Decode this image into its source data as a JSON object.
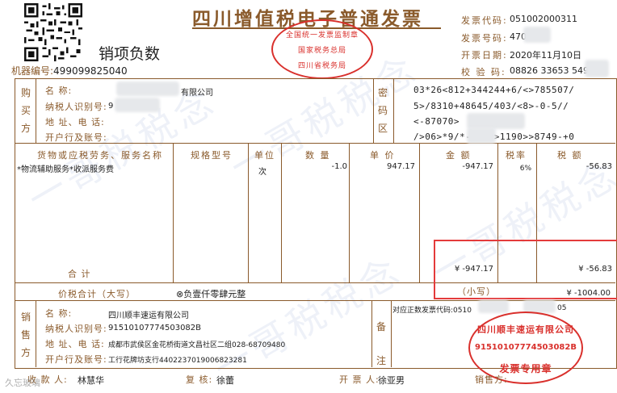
{
  "invoice": {
    "title": "四川增值税电子普通发票",
    "negative_mark": "销项负数",
    "machine_label": "机器编号:",
    "machine_no": "499099825040",
    "header": {
      "code_label": "发票代码:",
      "code": "051002000311",
      "no_label": "发票号码:",
      "no": "470",
      "date_label": "开票日期:",
      "date": "2020年11月10日",
      "check_label": "校 验 码:",
      "check": "08826 33653 549"
    }
  },
  "buyer": {
    "section": "购买方",
    "name_label": "名        称:",
    "name": "有限公司",
    "tax_label": "纳税人识别号:",
    "tax": "9",
    "addr_label": "地 址、电 话:",
    "bank_label": "开户行及账号:"
  },
  "cipher": {
    "section": "密码区",
    "lines": [
      "03*26<812+344244+6/<>785507/",
      "5>/8310+48645/403/<8>-0-5//",
      "<-87070>",
      "/>06>*9/*-11><>1190>>8749-+0"
    ]
  },
  "columns": {
    "name": "货物或应税劳务、服务名称",
    "spec": "规格型号",
    "unit": "单位",
    "qty": "数 量",
    "price": "单 价",
    "amount": "金 额",
    "rate": "税率",
    "tax": "税 额"
  },
  "items": [
    {
      "name": "*物流辅助服务*收派服务费",
      "unit": "次",
      "qty": "-1.0",
      "price": "947.17",
      "amount": "-947.17",
      "rate": "6%",
      "tax": "-56.83"
    }
  ],
  "totals": {
    "label": "合        计",
    "amount": "¥ -947.17",
    "tax": "¥ -56.83",
    "grand_label": "价税合计（大写）",
    "grand_words": "负壹仟零肆元整",
    "grand_symbol": "⊗",
    "small_label": "（小写）",
    "grand_small": "¥ -1004.00"
  },
  "seller": {
    "section": "销售方",
    "name_label": "名        称:",
    "name": "四川顺丰速运有限公司",
    "tax_label": "纳税人识别号:",
    "tax": "91510107774503082B",
    "addr_label": "地 址、电 话:",
    "addr": "成都市武侯区金花桥街道文昌社区二组028-68709480",
    "bank_label": "开户行及账号:",
    "bank": "工行花牌坊支行4402237019006823281"
  },
  "remarks": {
    "section": "备注",
    "text": "对应正数发票代码:0510",
    "text_end": "05"
  },
  "footer": {
    "payee_label": "收 款 人:",
    "payee": "林慧华",
    "reviewer_label": "复 核:",
    "reviewer": "徐蕾",
    "drawer_label": "开 票 人:",
    "drawer": "徐亚男",
    "seller_label": "销售方:"
  },
  "stamps": {
    "top_outer": "全国统一发票监制章",
    "top_mid": "国家税务总局",
    "top_bottom": "四川省税务局",
    "seller_company": "四川顺丰速运有限公司",
    "seller_tax": "91510107774503082B",
    "seller_use": "发票专用章"
  },
  "watermark": "一哥税税念",
  "corner_logo": "久忘玻璃",
  "colors": {
    "frame": "#8a5a2b",
    "stamp": "#d9302c",
    "highlight": "#e43b3b"
  }
}
